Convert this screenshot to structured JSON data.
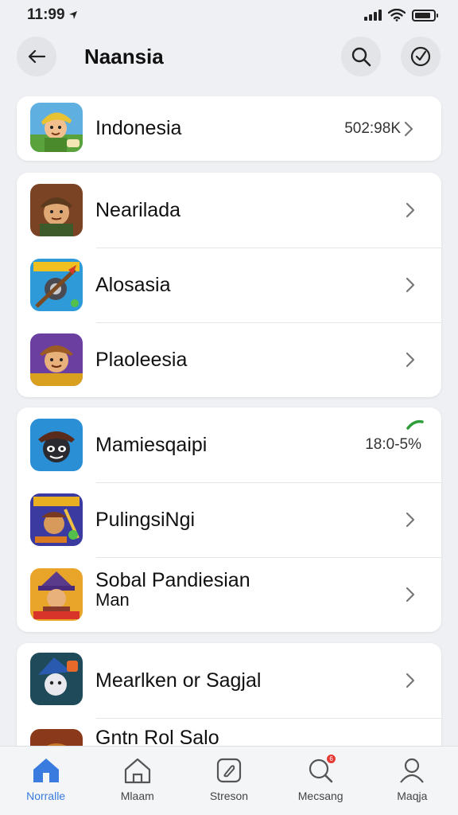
{
  "status_bar": {
    "time": "11:99"
  },
  "header": {
    "title": "Naansia"
  },
  "groups": [
    {
      "items": [
        {
          "label": "Indonesia",
          "value": "502:98K",
          "icon": "game-hero-icon"
        }
      ]
    },
    {
      "items": [
        {
          "label": "Nearilada",
          "icon": "game-soldier-icon"
        },
        {
          "label": "Alosasia",
          "icon": "game-crossbow-icon"
        },
        {
          "label": "Plaoleesia",
          "icon": "game-adventurer-icon"
        }
      ]
    },
    {
      "items": [
        {
          "label": "Mamiesqaipi",
          "value": "18:0-5%",
          "icon": "game-ninja-icon"
        },
        {
          "label": "PulingsiNgi",
          "icon": "game-warrior-icon"
        },
        {
          "label": "Sobal Pandiesian",
          "sub": "Man",
          "icon": "game-wizard-icon"
        }
      ]
    },
    {
      "items": [
        {
          "label": "Mearlken or Sagjal",
          "icon": "game-mage-icon"
        },
        {
          "label": "Gntn Rol Salo",
          "icon": "game-pirate-icon"
        }
      ]
    }
  ],
  "bottom_nav": [
    {
      "label": "Norralle",
      "icon": "home-icon",
      "active": true
    },
    {
      "label": "Mlaam",
      "icon": "store-icon"
    },
    {
      "label": "Streson",
      "icon": "tag-icon"
    },
    {
      "label": "Mecsang",
      "icon": "search-notification-icon",
      "badge": "6"
    },
    {
      "label": "Maqja",
      "icon": "profile-icon"
    }
  ],
  "colors": {
    "accent": "#3a7be0",
    "trend_green": "#2e9d3a",
    "badge_red": "#e53935"
  }
}
